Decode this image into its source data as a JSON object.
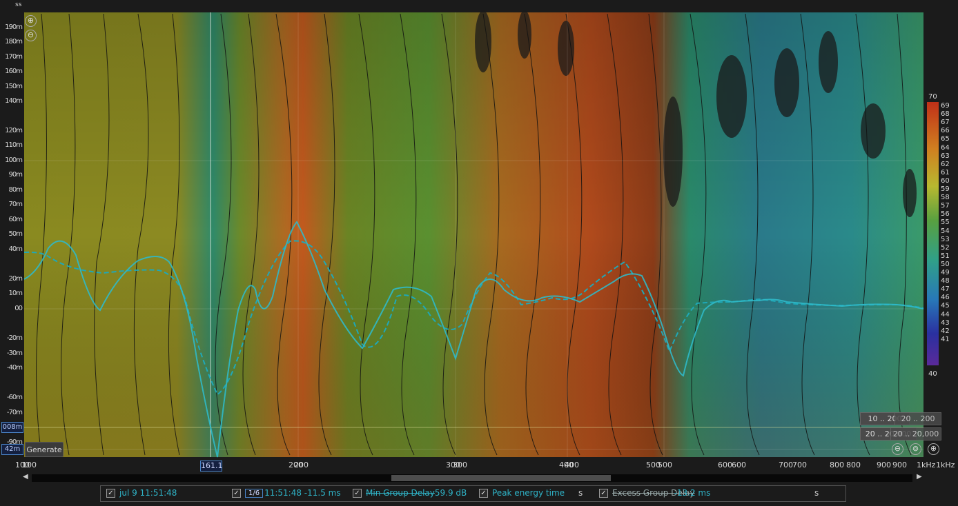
{
  "top_label": "ss",
  "y_ticks": [
    "190m",
    "180m",
    "170m",
    "160m",
    "150m",
    "140m",
    "120m",
    "110m",
    "100m",
    "90m",
    "80m",
    "70m",
    "60m",
    "50m",
    "40m",
    "20m",
    "10m",
    "00",
    "-20m",
    "-30m",
    "-40m",
    "-60m",
    "-70m",
    "-80m",
    "-90m"
  ],
  "x_ticks": [
    "100",
    "100",
    "200",
    "200",
    "300",
    "300",
    "400",
    "400",
    "500",
    "500",
    "600",
    "600",
    "700",
    "700",
    "800",
    "800",
    "900",
    "900",
    "1kHz",
    "1kHz"
  ],
  "cursor_x_label": "161.1",
  "cursor_y_label": "008m",
  "cursor_y_label2": "42m",
  "colorbar": {
    "max_label": "70",
    "min_label": "40",
    "ticks": [
      "69",
      "68",
      "67",
      "66",
      "65",
      "64",
      "63",
      "62",
      "61",
      "60",
      "59",
      "58",
      "57",
      "56",
      "55",
      "54",
      "53",
      "52",
      "51",
      "50",
      "49",
      "48",
      "47",
      "46",
      "45",
      "44",
      "43",
      "42",
      "41"
    ]
  },
  "buttons": {
    "generate": "Generate",
    "range_top_a": "10 .. 200",
    "range_top_b": "20 .. 200",
    "range_bottom_a": "20 .. 20,000",
    "range_bottom_b": "20 .. 20,000"
  },
  "icons": {
    "zoom_in": "⊕",
    "zoom_out": "⊖",
    "zoom_reset": "⊚"
  },
  "legend": {
    "item1": "jul 9 11:51:48",
    "item2_box": "1/6",
    "item2": "11:51:48 -11.5 ms",
    "item3": "Min Group Delay",
    "item3_value": "59.9 dB",
    "item4": "Peak energy time",
    "item4_unit": "s",
    "item5": "Excess Group Delay",
    "item5_value": "-13.2 ms",
    "item6_unit": "s",
    "check": "✓"
  },
  "colors": {
    "trace_solid": "#2fb9c8",
    "trace_dashed": "#1fa8b8",
    "accent_blue": "#4a84c8"
  }
}
